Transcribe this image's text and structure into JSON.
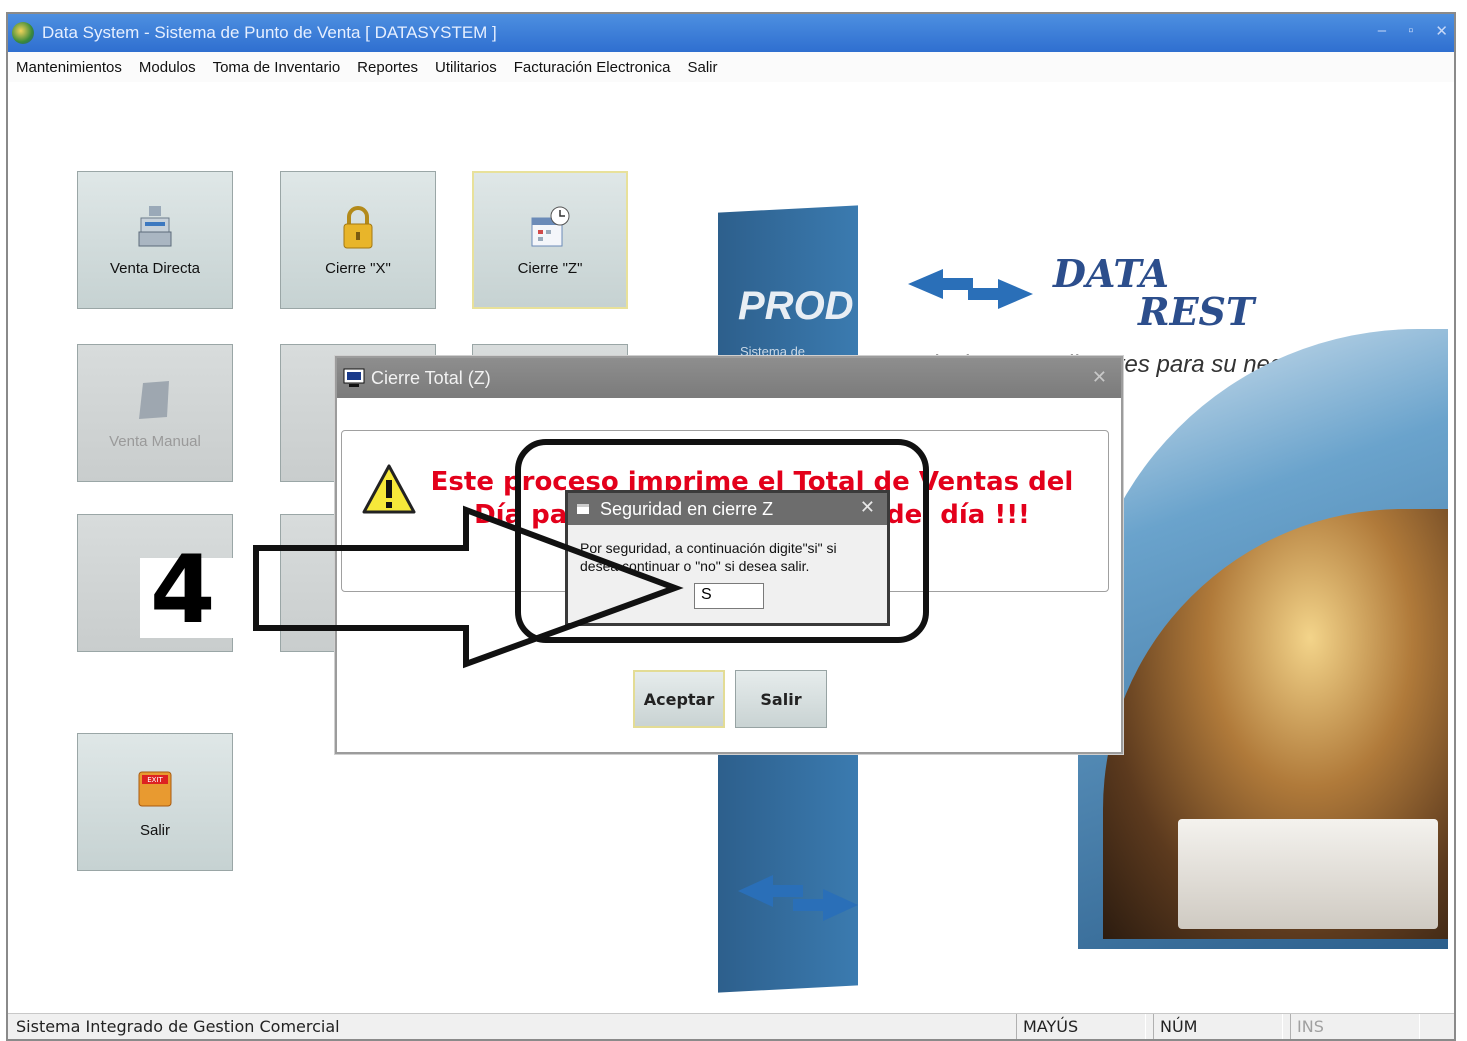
{
  "window": {
    "title": "Data System - Sistema de Punto de Venta [ DATASYSTEM ]",
    "controls": {
      "minimize": "–",
      "restore": "▫",
      "close": "✕"
    }
  },
  "menu": {
    "items": [
      "Mantenimientos",
      "Modulos",
      "Toma de Inventario",
      "Reportes",
      "Utilitarios",
      "Facturación Electronica",
      "Salir"
    ]
  },
  "tiles": {
    "venta_directa": "Venta Directa",
    "cierre_x": "Cierre \"X\"",
    "cierre_z": "Cierre \"Z\"",
    "venta_manual": "Venta Manual",
    "salir": "Salir"
  },
  "branding": {
    "prod": "PROD",
    "prod_sub": "Sistema de",
    "data": "DATA",
    "rest": "REST",
    "tagline": "Soluciones Inteligentes para su negocio"
  },
  "dialog_cierre": {
    "title": "Cierre Total (Z)",
    "message": "Este proceso imprime el Total de Ventas del Día para ejecutarse al Final del día !!!",
    "accept_label": "Aceptar",
    "exit_label": "Salir"
  },
  "dialog_seguridad": {
    "title": "Seguridad en cierre Z",
    "message": "Por seguridad, a continuación digite\"si\" si desea continuar o \"no\" si desea salir.",
    "input_value": "S"
  },
  "annotation": {
    "step_number": "4"
  },
  "statusbar": {
    "text": "Sistema Integrado de Gestion Comercial",
    "caps": "MAYÚS",
    "num": "NÚM",
    "ins": "INS"
  },
  "colors": {
    "titlebar": "#2f6fd0",
    "warning_text": "#e3001b",
    "brand_blue": "#2c4e8c"
  }
}
